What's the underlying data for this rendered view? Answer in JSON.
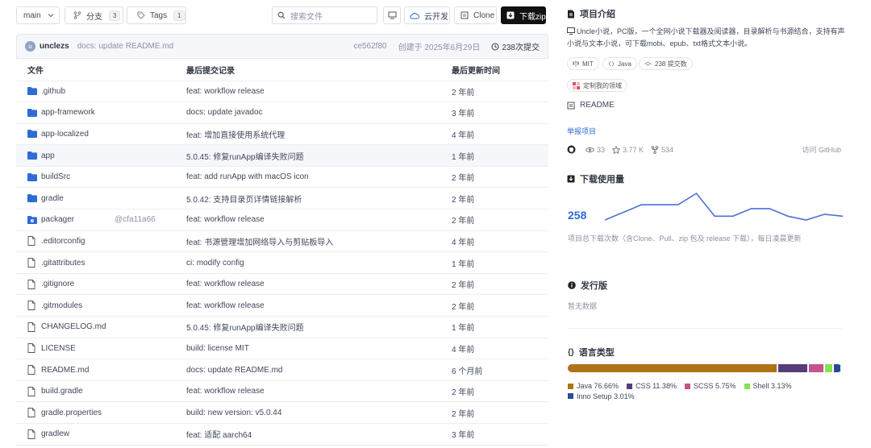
{
  "toolbar": {
    "branch": "main",
    "branches_label": "分支",
    "branches_count": "3",
    "tags_label": "Tags",
    "tags_count": "1",
    "search_placeholder": "搜索文件",
    "cloud_dev": "云开发",
    "clone": "Clone",
    "download_zip": "下载zip"
  },
  "commit": {
    "avatar_letter": "u",
    "author": "unclezs",
    "message": "docs: update README.md",
    "hash": "ce562f80",
    "date": "创建于 2025年6月29日",
    "count": "238次提交"
  },
  "table": {
    "headers": [
      "文件",
      "最后提交记录",
      "最后更新时间"
    ],
    "rows": [
      {
        "name": ".github",
        "type": "folder",
        "msg": "feat: workflow release",
        "time": "2 年前"
      },
      {
        "name": "app-framework",
        "type": "folder",
        "msg": "docs: update javadoc",
        "time": "3 年前"
      },
      {
        "name": "app-localized",
        "type": "folder",
        "msg": "feat: 增加直接使用系统代理",
        "time": "4 年前"
      },
      {
        "name": "app",
        "type": "folder",
        "msg": "5.0.45: 修复runApp编译失败问题",
        "time": "1 年前",
        "highlight": true
      },
      {
        "name": "buildSrc",
        "type": "folder",
        "msg": "feat: add runApp with macOS icon",
        "time": "2 年前"
      },
      {
        "name": "gradle",
        "type": "folder",
        "msg": "5.0.42: 支持目录页详情链接解析",
        "time": "2 年前"
      },
      {
        "name": "packager",
        "type": "submodule",
        "submodule": "@cfa11a66",
        "msg": "feat: workflow release",
        "time": "2 年前"
      },
      {
        "name": ".editorconfig",
        "type": "file",
        "msg": "feat: 书源管理增加网络导入与剪贴板导入",
        "time": "4 年前"
      },
      {
        "name": ".gitattributes",
        "type": "file",
        "msg": "ci: modify config",
        "time": "1 年前"
      },
      {
        "name": ".gitignore",
        "type": "file",
        "msg": "feat: workflow release",
        "time": "2 年前"
      },
      {
        "name": ".gitmodules",
        "type": "file",
        "msg": "feat: workflow release",
        "time": "2 年前"
      },
      {
        "name": "CHANGELOG.md",
        "type": "file",
        "msg": "5.0.45: 修复runApp编译失败问题",
        "time": "1 年前"
      },
      {
        "name": "LICENSE",
        "type": "file",
        "msg": "build: license MIT",
        "time": "4 年前"
      },
      {
        "name": "README.md",
        "type": "file",
        "msg": "docs: update README.md",
        "time": "6 个月前"
      },
      {
        "name": "build.gradle",
        "type": "file",
        "msg": "feat: workflow release",
        "time": "2 年前"
      },
      {
        "name": "gradle.properties",
        "type": "file",
        "msg": "build: new version: v5.0.44",
        "time": "2 年前"
      },
      {
        "name": "gradlew",
        "type": "file",
        "msg": "feat: 适配 aarch64",
        "time": "3 年前"
      }
    ]
  },
  "side": {
    "intro_title": "项目介绍",
    "description": "Uncle小说，PC版，一个全网小说下载器及阅读器，目录解析与书源结合，支持有声小说与文本小说，可下载mobi、epub、txt格式文本小说。",
    "tag_license": "MIT",
    "tag_lang": "Java",
    "tag_commits": "238 提交数",
    "tag_domain": "定制我的领域",
    "readme": "README",
    "report": "举报项目",
    "watch": "33",
    "stars": "3.77 K",
    "forks": "534",
    "visit": "访问 GitHub",
    "downloads_title": "下载使用量",
    "downloads_count": "258",
    "downloads_note": "项目总下载次数（含Clone、Pull、zip 包及 release 下载），每日凌晨更新",
    "release_title": "发行版",
    "release_empty": "暂无数据",
    "lang_title": "语言类型",
    "accent_color": "#2e6bd6",
    "spark_color": "#4f6fd6"
  },
  "spark_values": [
    0,
    2,
    4,
    4,
    4,
    7,
    1,
    1,
    3,
    3,
    1,
    0,
    1.5,
    1
  ],
  "languages": [
    {
      "name": "Java",
      "pct": "76.66%",
      "value": 76.66,
      "color": "#b07219"
    },
    {
      "name": "CSS",
      "pct": "11.38%",
      "value": 11.38,
      "color": "#563d7c"
    },
    {
      "name": "SCSS",
      "pct": "5.75%",
      "value": 5.75,
      "color": "#c6538c"
    },
    {
      "name": "Shell",
      "pct": "3.13%",
      "value": 3.13,
      "color": "#89e051"
    },
    {
      "name": "Inno Setup",
      "pct": "3.01%",
      "value": 3.01,
      "color": "#264b99"
    }
  ]
}
